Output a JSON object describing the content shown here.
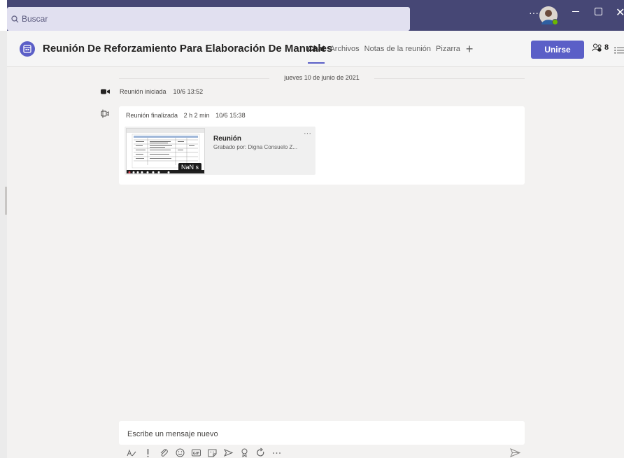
{
  "titlebar": {
    "search_placeholder": "Buscar",
    "more_label": "···"
  },
  "header": {
    "meeting_title": "Reunión De Reforzamiento Para Elaboración De Manuales",
    "tabs": [
      {
        "label": "Chat",
        "active": true
      },
      {
        "label": "Archivos"
      },
      {
        "label": "Notas de la reunión"
      },
      {
        "label": "Pizarra"
      }
    ],
    "join_label": "Unirse",
    "participant_count": "8"
  },
  "chat": {
    "date_divider": "jueves 10 de junio de 2021",
    "events": [
      {
        "text": "Reunión iniciada",
        "time": "10/6 13:52"
      }
    ],
    "ended": {
      "text": "Reunión finalizada",
      "duration": "2 h 2 min",
      "time": "10/6 15:38"
    },
    "recording": {
      "title": "Reunión",
      "recorded_by": "Grabado por: Digna Consuelo Z...",
      "duration_badge": "NaN s",
      "more_label": "···"
    }
  },
  "compose": {
    "placeholder": "Escribe un mensaje nuevo",
    "toolbar_icons": [
      "format-icon",
      "important-icon",
      "attach-icon",
      "emoji-icon",
      "gif-icon",
      "sticker-icon",
      "meet-now-icon",
      "praise-icon",
      "loop-icon",
      "more-icon"
    ]
  },
  "colors": {
    "titlebar_bg": "#464775",
    "accent": "#5b5fc7",
    "chat_bg": "#f3f2f1"
  }
}
